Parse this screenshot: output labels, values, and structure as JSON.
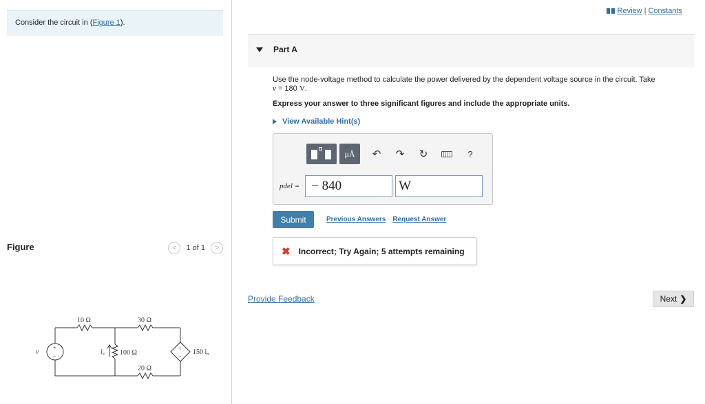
{
  "left": {
    "intro_text": "Consider the circuit in (",
    "intro_link": "Figure 1",
    "intro_end": ").",
    "figure_title": "Figure",
    "pager_count": "1 of 1",
    "pager_prev": "<",
    "pager_next": ">"
  },
  "circuit": {
    "r1": "10 Ω",
    "r2": "30 Ω",
    "r3": "100 Ω",
    "r4": "20 Ω",
    "dep_source": "150 i",
    "dep_sub": "σ",
    "source_label": "v",
    "current_label": "i",
    "current_sub": "σ",
    "plus": "+",
    "minus": "−"
  },
  "nav": {
    "review": "Review",
    "separator": "|",
    "constants": "Constants"
  },
  "part": {
    "title": "Part A"
  },
  "question": {
    "line1": "Use the node-voltage method to calculate the power delivered by the dependent voltage source in the circuit. Take",
    "var": "v",
    "eq": " = 180 ",
    "unit": "V",
    "end": ".",
    "instructions": "Express your answer to three significant figures and include the appropriate units.",
    "hints": "View Available Hint(s)"
  },
  "answer": {
    "label": "pdel =",
    "value": "− 840",
    "unit": "W",
    "mu_label": "μÅ",
    "help": "?"
  },
  "actions": {
    "submit": "Submit",
    "previous": "Previous Answers",
    "request": "Request Answer"
  },
  "feedback": {
    "icon": "✖",
    "text": "Incorrect; Try Again; 5 attempts remaining"
  },
  "footer": {
    "provide_feedback": "Provide Feedback",
    "next": "Next",
    "next_chev": "❯"
  },
  "colors": {
    "link": "#2f6fa9",
    "submit": "#3f7fab",
    "error": "#d33b2d",
    "toolbar": "#5e6671"
  }
}
